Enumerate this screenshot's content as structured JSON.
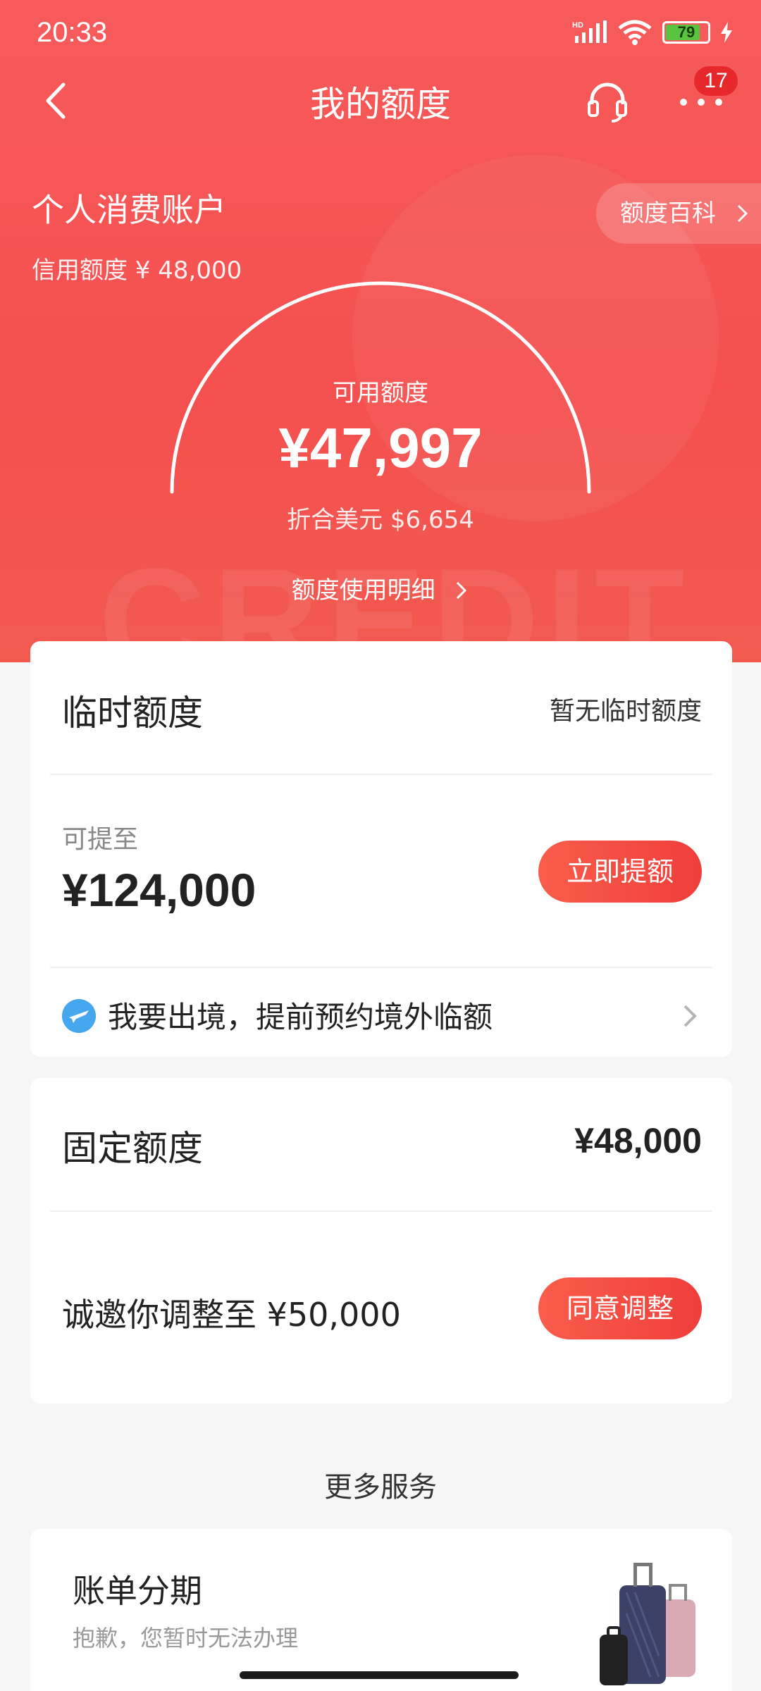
{
  "status_bar": {
    "time": "20:33",
    "battery": "79",
    "battery_percent": 79,
    "network": "HD"
  },
  "nav": {
    "title": "我的额度",
    "badge_count": "17",
    "icons": [
      "back-arrow-icon",
      "headset-icon",
      "more-icon"
    ]
  },
  "account": {
    "name": "个人消费账户",
    "credit_limit_line": "信用额度 ¥ 48,000",
    "baike_label": "额度百科",
    "available_label": "可用额度",
    "available_amount": "¥47,997",
    "usd_line": "折合美元 $6,654",
    "usage_link": "额度使用明细",
    "watermark": "CREDIT"
  },
  "temp_quota": {
    "title": "临时额度",
    "status": "暂无临时额度",
    "up_to_label": "可提至",
    "up_to_amount": "¥124,000",
    "raise_button": "立即提额",
    "abroad_text": "我要出境，提前预约境外临额"
  },
  "fixed_quota": {
    "title": "固定额度",
    "amount": "¥48,000",
    "invite_text": "诚邀你调整至 ¥50,000",
    "agree_button": "同意调整"
  },
  "more_services": {
    "title": "更多服务",
    "items": [
      {
        "title": "账单分期",
        "desc": "抱歉，您暂时无法办理"
      }
    ]
  },
  "colors": {
    "brand_red": "#f4504f",
    "button_red": "#ef3e3a",
    "battery_green": "#58c440"
  }
}
